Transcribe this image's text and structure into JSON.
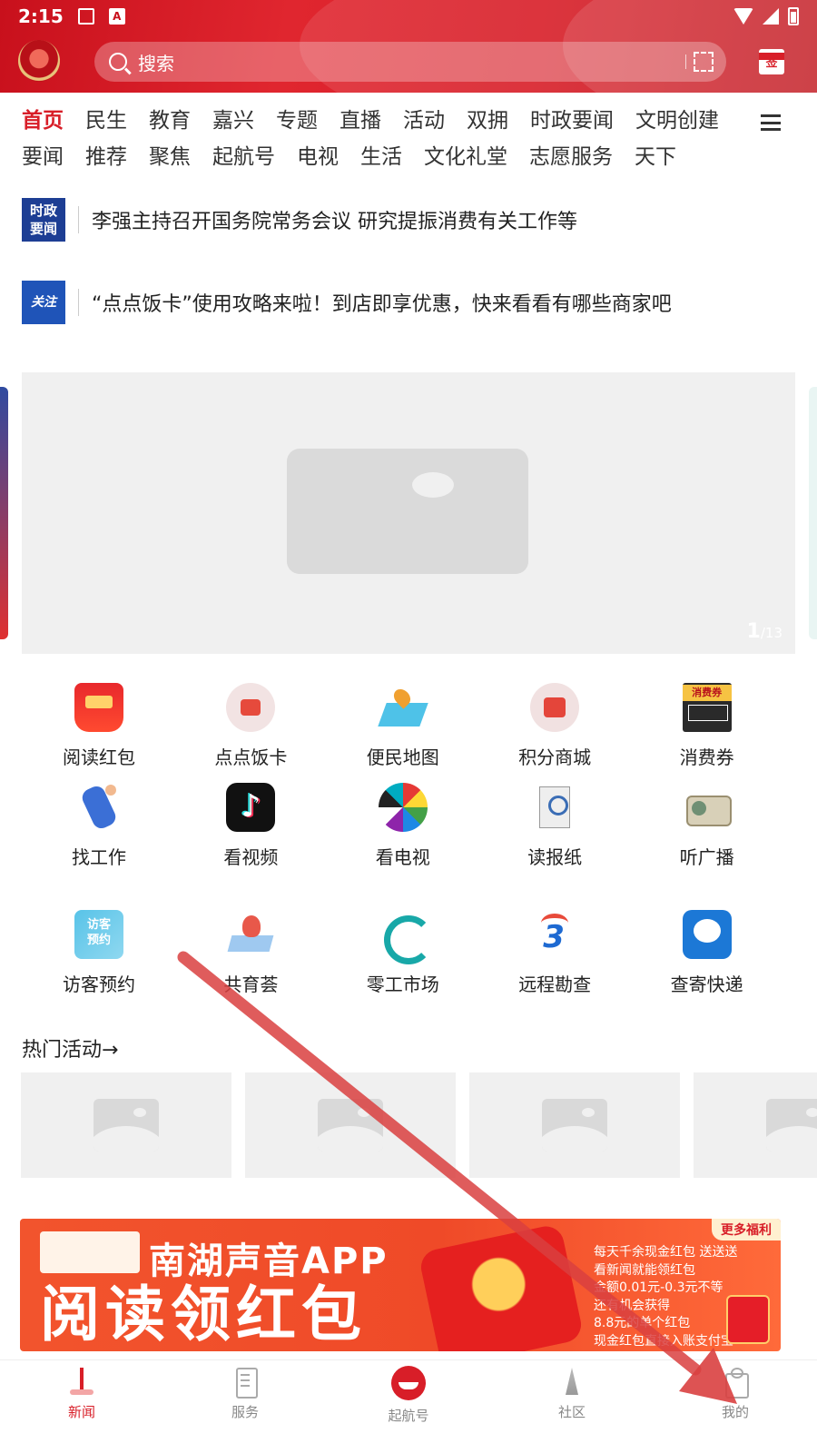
{
  "status_bar": {
    "time": "2:15"
  },
  "header": {
    "search_placeholder": "搜索",
    "sign_label": "签"
  },
  "channels": {
    "row1": [
      "首页",
      "民生",
      "教育",
      "嘉兴",
      "专题",
      "直播",
      "活动",
      "双拥",
      "时政要闻",
      "文明创建"
    ],
    "row2": [
      "要闻",
      "推荐",
      "聚焦",
      "起航号",
      "电视",
      "生活",
      "文化礼堂",
      "志愿服务",
      "天下"
    ],
    "active": "首页"
  },
  "news": [
    {
      "badge": "时政要闻",
      "text": "李强主持召开国务院常务会议 研究提振消费有关工作等"
    },
    {
      "badge": "关注",
      "text": "“点点饭卡”使用攻略来啦！到店即享优惠，快来看看有哪些商家吧"
    }
  ],
  "banner": {
    "pager_current": "1",
    "pager_total": "/13"
  },
  "services": [
    {
      "label": "阅读红包",
      "icon": "red-packet-icon"
    },
    {
      "label": "点点饭卡",
      "icon": "wallet-icon"
    },
    {
      "label": "便民地图",
      "icon": "map-icon"
    },
    {
      "label": "积分商城",
      "icon": "cart-icon"
    },
    {
      "label": "消费券",
      "icon": "coupon-icon"
    },
    {
      "label": "找工作",
      "icon": "job-icon"
    },
    {
      "label": "看视频",
      "icon": "tiktok-icon"
    },
    {
      "label": "看电视",
      "icon": "tv-icon"
    },
    {
      "label": "读报纸",
      "icon": "newspaper-icon"
    },
    {
      "label": "听广播",
      "icon": "radio-icon"
    },
    {
      "label": "访客预约",
      "icon": "visitor-icon"
    },
    {
      "label": "共育荟",
      "icon": "book-icon"
    },
    {
      "label": "零工市场",
      "icon": "gig-market-icon"
    },
    {
      "label": "远程勘查",
      "icon": "survey-icon"
    },
    {
      "label": "查寄快递",
      "icon": "express-icon"
    }
  ],
  "hot": {
    "title": "热门活动→"
  },
  "promo": {
    "app_name": "南湖声音APP",
    "headline": "阅读领红包",
    "tag": "更多福利",
    "lines": [
      "每天千余现金红包 送送送",
      "看新闻就能领红包",
      "金额0.01元-0.3元不等",
      "还有机会获得",
      "8.8元的单个红包",
      "现金红包直接入账支付宝"
    ]
  },
  "tabbar": [
    {
      "label": "新闻",
      "icon": "news-tab-icon"
    },
    {
      "label": "服务",
      "icon": "service-tab-icon"
    },
    {
      "label": "起航号",
      "icon": "boat-tab-icon"
    },
    {
      "label": "社区",
      "icon": "community-tab-icon"
    },
    {
      "label": "我的",
      "icon": "me-tab-icon"
    }
  ],
  "colors": {
    "brand_red": "#d81e28",
    "badge_blue": "#1d3e94",
    "annotation_arrow": "#d94040"
  }
}
